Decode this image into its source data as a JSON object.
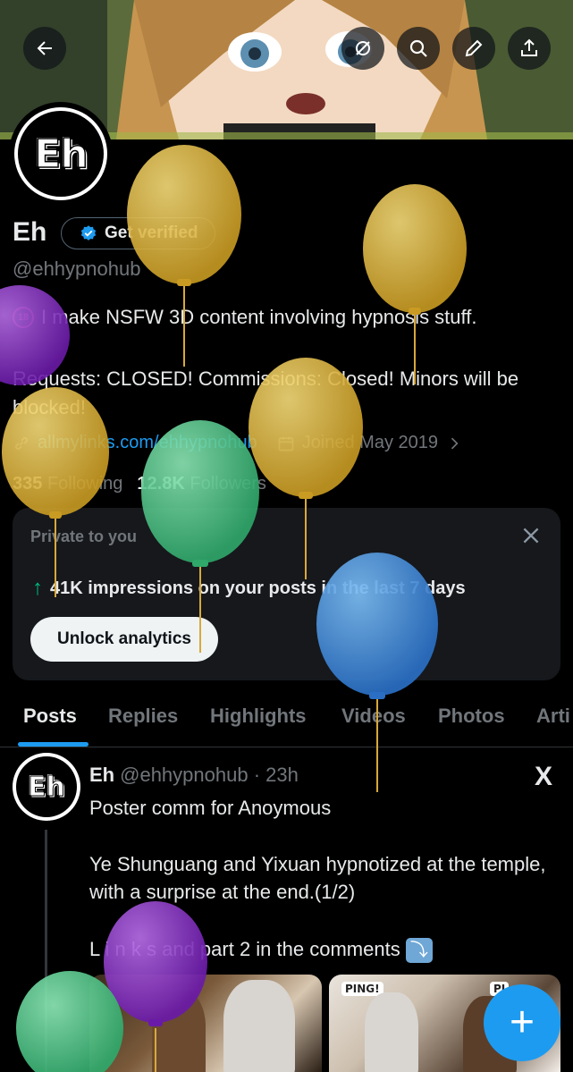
{
  "header": {
    "back_icon": "arrow-left-icon",
    "actions": [
      "hide-icon",
      "search-icon",
      "edit-icon",
      "share-icon"
    ]
  },
  "profile": {
    "avatar_text": "Eh",
    "name": "Eh",
    "verify_label": "Get verified",
    "handle": "@ehhypnohub",
    "age_badge": "18",
    "bio_line1": "I make NSFW 3D content involving hypnosis stuff.",
    "bio_line2": "Requests: CLOSED! Commissions: Closed! Minors will be blocked!",
    "link": "allmylinks.com/ehhypnohub",
    "joined": "Joined May 2019",
    "following_count": "335",
    "following_label": "Following",
    "followers_count": "12.8K",
    "followers_label": "Followers"
  },
  "analytics_card": {
    "title": "Private to you",
    "impressions_text": "41K impressions on your posts in the last 7 days",
    "button_label": "Unlock analytics"
  },
  "tabs": [
    "Posts",
    "Replies",
    "Highlights",
    "Videos",
    "Photos",
    "Arti"
  ],
  "active_tab": "Posts",
  "post": {
    "avatar_text": "Eh",
    "name": "Eh",
    "handle_time": "@ehhypnohub · 23h",
    "x_logo": "X",
    "line1": "Poster comm for Anoymous",
    "line2": "Ye Shunguang and Yixuan hypnotized at the temple, with a surprise at the end.(1/2)",
    "line3": "L i n k s and part 2 in the comments",
    "line3_emoji": "⤵",
    "media_caption1": "PING!",
    "media_caption2": "PI"
  },
  "fab_label": "+",
  "colors": {
    "accent": "#1d9bf0",
    "balloon_gold": "#e2b93b",
    "balloon_green": "#4fc98a",
    "balloon_purple": "#8b2fc9",
    "balloon_blue": "#3a8fe0"
  }
}
